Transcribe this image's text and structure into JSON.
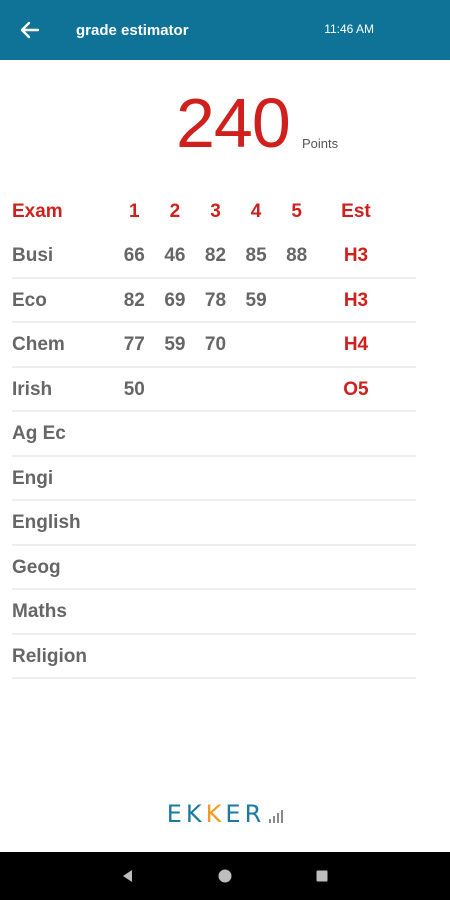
{
  "app_bar": {
    "title": "grade estimator",
    "clock": "11:46 AM",
    "colors": {
      "background": "#0f7397"
    }
  },
  "summary": {
    "points": "240",
    "points_label": "Points"
  },
  "table": {
    "headers": [
      "Exam",
      "1",
      "2",
      "3",
      "4",
      "5",
      "Est"
    ],
    "rows": [
      {
        "subject": "Busi",
        "scores": [
          "66",
          "46",
          "82",
          "85",
          "88"
        ],
        "est": "H3"
      },
      {
        "subject": "Eco",
        "scores": [
          "82",
          "69",
          "78",
          "59",
          ""
        ],
        "est": "H3"
      },
      {
        "subject": "Chem",
        "scores": [
          "77",
          "59",
          "70",
          "",
          ""
        ],
        "est": "H4"
      },
      {
        "subject": "Irish",
        "scores": [
          "50",
          "",
          "",
          "",
          ""
        ],
        "est": "O5"
      },
      {
        "subject": "Ag Ec",
        "scores": [
          "",
          "",
          "",
          "",
          ""
        ],
        "est": ""
      },
      {
        "subject": "Engi",
        "scores": [
          "",
          "",
          "",
          "",
          ""
        ],
        "est": ""
      },
      {
        "subject": "English",
        "scores": [
          "",
          "",
          "",
          "",
          ""
        ],
        "est": ""
      },
      {
        "subject": "Geog",
        "scores": [
          "",
          "",
          "",
          "",
          ""
        ],
        "est": ""
      },
      {
        "subject": "Maths",
        "scores": [
          "",
          "",
          "",
          "",
          ""
        ],
        "est": ""
      },
      {
        "subject": "Religion",
        "scores": [
          "",
          "",
          "",
          "",
          ""
        ],
        "est": ""
      }
    ]
  },
  "brand": {
    "logo_text": "EKKER",
    "colors": {
      "primary": "#1a7aa3",
      "accent": "#f29b21"
    }
  },
  "navigation": {
    "icons": [
      "back-triangle-icon",
      "home-circle-icon",
      "recents-square-icon"
    ]
  },
  "colors": {
    "red": "#d0201e",
    "text_gray": "#666666"
  }
}
